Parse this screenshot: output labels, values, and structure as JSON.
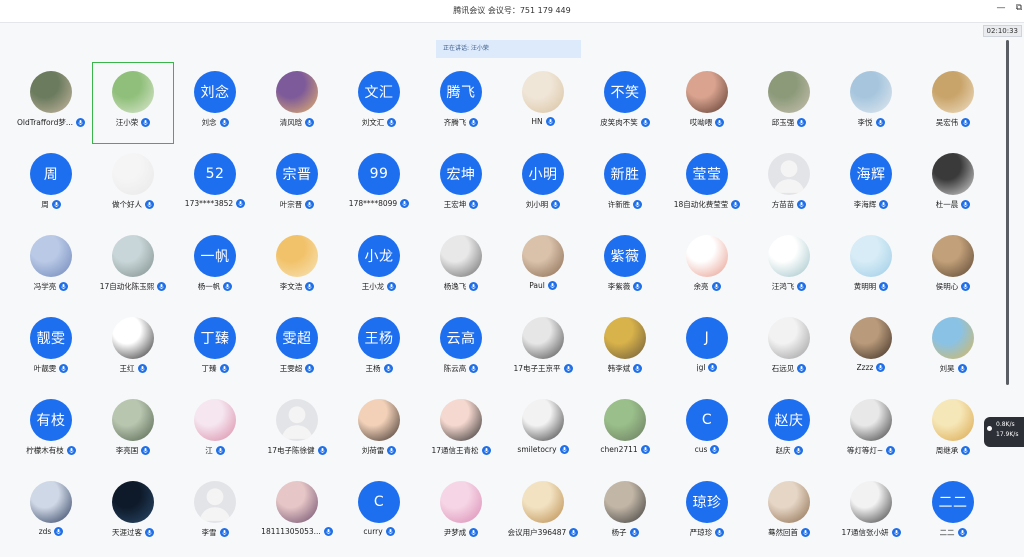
{
  "window": {
    "title": "腾讯会议 会议号：751 179 449",
    "minimize_glyph": "—",
    "restore_glyph": "⧉"
  },
  "timer": "02:10:33",
  "speaking": "正在讲话: 汪小荣",
  "network": {
    "up": "0.8K/s",
    "down": "17.9K/s"
  },
  "colors": {
    "brand": "#1e6ff0",
    "active_border": "#39b54a"
  },
  "participants": [
    [
      {
        "name": "OldTrafford梦...",
        "avatar": "photo",
        "tone": [
          "#6b7b5e",
          "#c9b9a2"
        ]
      },
      {
        "name": "汪小荣",
        "avatar": "photo",
        "tone": [
          "#8fbf7a",
          "#dfe8d2"
        ],
        "active": true
      },
      {
        "name": "刘念",
        "avatar": "text",
        "avatar_text": "刘念"
      },
      {
        "name": "清风晗",
        "avatar": "photo",
        "tone": [
          "#7d5a9a",
          "#e7b46b"
        ]
      },
      {
        "name": "刘文汇",
        "avatar": "text",
        "avatar_text": "文汇"
      },
      {
        "name": "齐腾飞",
        "avatar": "text",
        "avatar_text": "腾飞"
      },
      {
        "name": "HN",
        "avatar": "photo",
        "tone": [
          "#f0e6d8",
          "#d8c2a0"
        ]
      },
      {
        "name": "皮笑肉不笑",
        "avatar": "text",
        "avatar_text": "不笑"
      },
      {
        "name": "哎呦喂",
        "avatar": "photo",
        "tone": [
          "#d9a38f",
          "#5a3a2f"
        ]
      },
      {
        "name": "邱玉强",
        "avatar": "photo",
        "tone": [
          "#8c9a7a",
          "#c9c1b0"
        ]
      },
      {
        "name": "李悦",
        "avatar": "photo",
        "tone": [
          "#a7c6de",
          "#e2e9ef"
        ]
      },
      {
        "name": "吴宏伟",
        "avatar": "photo",
        "tone": [
          "#c9a46a",
          "#efe0c6"
        ]
      }
    ],
    [
      {
        "name": "周",
        "avatar": "text",
        "avatar_text": "周"
      },
      {
        "name": "做个好人",
        "avatar": "photo",
        "tone": [
          "#f5f5f5",
          "#e8e8e8"
        ]
      },
      {
        "name": "173****3852",
        "avatar": "text",
        "avatar_text": "52"
      },
      {
        "name": "叶宗晋",
        "avatar": "text",
        "avatar_text": "宗晋"
      },
      {
        "name": "178****8099",
        "avatar": "text",
        "avatar_text": "99"
      },
      {
        "name": "王宏坤",
        "avatar": "text",
        "avatar_text": "宏坤"
      },
      {
        "name": "刘小明",
        "avatar": "text",
        "avatar_text": "小明"
      },
      {
        "name": "许新胜",
        "avatar": "text",
        "avatar_text": "新胜"
      },
      {
        "name": "18自动化费莹莹",
        "avatar": "text",
        "avatar_text": "莹莹"
      },
      {
        "name": "方苗苗",
        "avatar": "blank"
      },
      {
        "name": "李海辉",
        "avatar": "text",
        "avatar_text": "海辉"
      },
      {
        "name": "杜一晨",
        "avatar": "photo",
        "tone": [
          "#3a3a3a",
          "#d9d9d9"
        ]
      }
    ],
    [
      {
        "name": "冯学亮",
        "avatar": "photo",
        "tone": [
          "#b9c9e6",
          "#6f86b8"
        ]
      },
      {
        "name": "17自动化陈玉熙",
        "avatar": "photo",
        "tone": [
          "#c9d6d9",
          "#7e8f8a"
        ]
      },
      {
        "name": "杨一帆",
        "avatar": "text",
        "avatar_text": "一帆"
      },
      {
        "name": "李文浩",
        "avatar": "photo",
        "tone": [
          "#f2c26a",
          "#f6e4b8"
        ]
      },
      {
        "name": "王小龙",
        "avatar": "text",
        "avatar_text": "小龙"
      },
      {
        "name": "杨逸飞",
        "avatar": "photo",
        "tone": [
          "#e8e8e8",
          "#6a6a6a"
        ]
      },
      {
        "name": "Paul",
        "avatar": "photo",
        "tone": [
          "#d9c1aa",
          "#8a6b52"
        ]
      },
      {
        "name": "李紫薇",
        "avatar": "text",
        "avatar_text": "紫薇"
      },
      {
        "name": "余亮",
        "avatar": "photo",
        "tone": [
          "#ffffff",
          "#e69a8a"
        ]
      },
      {
        "name": "汪鸿飞",
        "avatar": "photo",
        "tone": [
          "#ffffff",
          "#9ec2c7"
        ]
      },
      {
        "name": "黄明明",
        "avatar": "photo",
        "tone": [
          "#d7ecf6",
          "#9ccce6"
        ]
      },
      {
        "name": "侯明心",
        "avatar": "photo",
        "tone": [
          "#c2a079",
          "#5a4533"
        ]
      }
    ],
    [
      {
        "name": "叶靓雯",
        "avatar": "text",
        "avatar_text": "靓雯"
      },
      {
        "name": "王红",
        "avatar": "photo",
        "tone": [
          "#ffffff",
          "#2b2b2b"
        ]
      },
      {
        "name": "丁臻",
        "avatar": "text",
        "avatar_text": "丁臻"
      },
      {
        "name": "王雯超",
        "avatar": "text",
        "avatar_text": "雯超"
      },
      {
        "name": "王杨",
        "avatar": "text",
        "avatar_text": "王杨"
      },
      {
        "name": "陈云高",
        "avatar": "text",
        "avatar_text": "云高"
      },
      {
        "name": "17电子王京平",
        "avatar": "photo",
        "tone": [
          "#e6e6e6",
          "#4a4a4a"
        ]
      },
      {
        "name": "韩李斌",
        "avatar": "photo",
        "tone": [
          "#d8b24a",
          "#6a5a3a"
        ]
      },
      {
        "name": "jgl",
        "avatar": "text",
        "avatar_text": "J"
      },
      {
        "name": "石远见",
        "avatar": "photo",
        "tone": [
          "#f2f2f2",
          "#9a9a9a"
        ]
      },
      {
        "name": "Zzzz",
        "avatar": "photo",
        "tone": [
          "#b99a7a",
          "#3a2d24"
        ]
      },
      {
        "name": "刘昊",
        "avatar": "photo",
        "tone": [
          "#8ac2e6",
          "#d9b85a"
        ]
      }
    ],
    [
      {
        "name": "柠檬木有枝",
        "avatar": "text",
        "avatar_text": "有枝"
      },
      {
        "name": "李亮国",
        "avatar": "photo",
        "tone": [
          "#b8c6b0",
          "#54634e"
        ]
      },
      {
        "name": "江",
        "avatar": "photo",
        "tone": [
          "#f5e6ef",
          "#d98aa6"
        ]
      },
      {
        "name": "17电子陈徐健",
        "avatar": "blank"
      },
      {
        "name": "刘荷雷",
        "avatar": "photo",
        "tone": [
          "#f2d1b8",
          "#3a2f2a"
        ]
      },
      {
        "name": "17通信王青松",
        "avatar": "photo",
        "tone": [
          "#f5d8cf",
          "#2a2a2a"
        ]
      },
      {
        "name": "smiletocry",
        "avatar": "photo",
        "tone": [
          "#f2f2f2",
          "#3a3a3a"
        ]
      },
      {
        "name": "chen2711",
        "avatar": "photo",
        "tone": [
          "#9abf8a",
          "#6a7a60"
        ]
      },
      {
        "name": "cus",
        "avatar": "text",
        "avatar_text": "C"
      },
      {
        "name": "赵庆",
        "avatar": "text",
        "avatar_text": "赵庆"
      },
      {
        "name": "等灯等灯~",
        "avatar": "photo",
        "tone": [
          "#e8e8e8",
          "#3a3a3a"
        ]
      },
      {
        "name": "周继承",
        "avatar": "photo",
        "tone": [
          "#f6e7b8",
          "#d9a64a"
        ]
      }
    ],
    [
      {
        "name": "zds",
        "avatar": "photo",
        "tone": [
          "#cfd8e6",
          "#2a3a5a"
        ]
      },
      {
        "name": "天涯过客",
        "avatar": "photo",
        "tone": [
          "#0e1a2a",
          "#2a4a6a"
        ]
      },
      {
        "name": "李雪",
        "avatar": "blank"
      },
      {
        "name": "18111305053...",
        "avatar": "photo",
        "tone": [
          "#e6c6c6",
          "#6a4a6a"
        ]
      },
      {
        "name": "curry",
        "avatar": "text",
        "avatar_text": "C"
      },
      {
        "name": "尹梦成",
        "avatar": "photo",
        "tone": [
          "#f6d6e6",
          "#d98ab2"
        ]
      },
      {
        "name": "会议用户396487",
        "avatar": "photo",
        "tone": [
          "#f2e2c2",
          "#b98a4a"
        ]
      },
      {
        "name": "杨子",
        "avatar": "photo",
        "tone": [
          "#c2b6a6",
          "#3a3a3a"
        ]
      },
      {
        "name": "严琼珍",
        "avatar": "text",
        "avatar_text": "琼珍"
      },
      {
        "name": "蓦然回首",
        "avatar": "photo",
        "tone": [
          "#e6d6c6",
          "#8a6a4a"
        ]
      },
      {
        "name": "17通信张小妍",
        "avatar": "photo",
        "tone": [
          "#f2f2f2",
          "#3a3a3a"
        ]
      },
      {
        "name": "二二",
        "avatar": "text",
        "avatar_text": "二二"
      }
    ]
  ]
}
